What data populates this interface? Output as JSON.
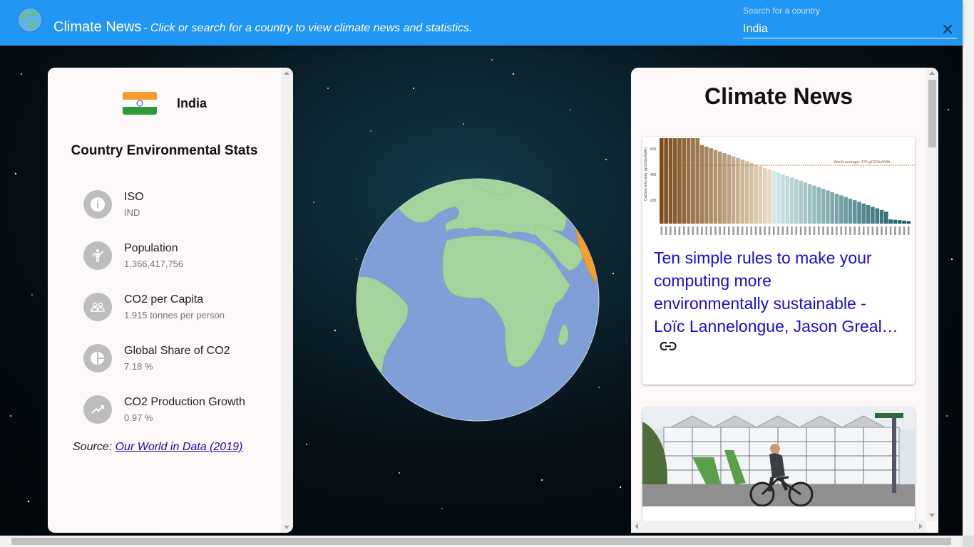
{
  "header": {
    "title": "Climate News",
    "subtitle": "- Click or search for a country to view climate news and statistics.",
    "search_label": "Search for a country",
    "search_value": "India",
    "background_color": "#2196f3"
  },
  "country_panel": {
    "country_name": "India",
    "stats_title": "Country Environmental Stats",
    "stats": [
      {
        "label": "ISO",
        "value": "IND",
        "icon": "info-icon"
      },
      {
        "label": "Population",
        "value": "1,366,417,756",
        "icon": "person-icon"
      },
      {
        "label": "CO2 per Capita",
        "value": "1.915 tonnes per person",
        "icon": "people-icon"
      },
      {
        "label": "Global Share of CO2",
        "value": "7.18 %",
        "icon": "pie-chart-icon"
      },
      {
        "label": "CO2 Production Growth",
        "value": "0.97 %",
        "icon": "trending-up-icon"
      }
    ],
    "source_prefix": "Source:",
    "source_link": "Our World in Data (2019)"
  },
  "globe": {
    "ocean_color": "#7f9fd6",
    "land_color": "#a3d49b",
    "highlight_color": "#f5a02a"
  },
  "news_panel": {
    "title": "Climate News",
    "articles": [
      {
        "headline": "Ten simple rules to make your computing more environmentally sustainable - Loïc Lannelongue, Jason Greal…",
        "headline_lines": [
          "Ten simple rules to make your",
          "computing more",
          "environmentally sustainable -",
          "Loïc Lannelongue, Jason Greal…"
        ],
        "chart_caption": "World average: 475 gCO2e/kWh",
        "chart_ylabel": "Carbon Intensity (gCO2e/kWh)",
        "chart_ticks": [
          "200",
          "400",
          "600"
        ]
      },
      {
        "headline": ""
      }
    ]
  }
}
